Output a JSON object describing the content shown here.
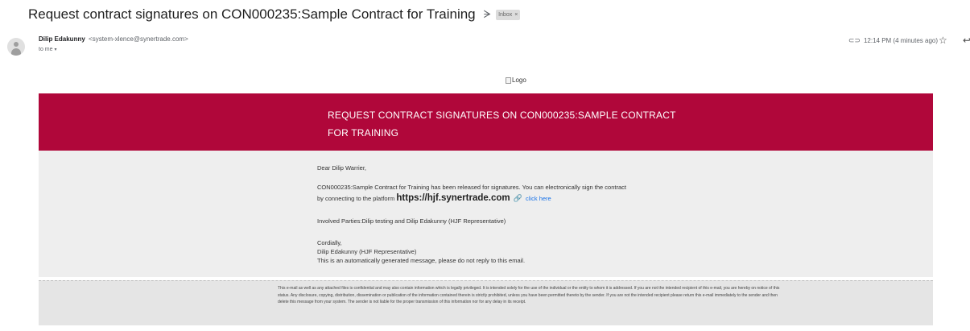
{
  "email": {
    "subject": "Request contract signatures on CON000235:Sample Contract for Training",
    "importance_icon": "label-importance-icon",
    "inbox_label": "Inbox",
    "inbox_close": "×",
    "sender_name": "Dilip Edakunny",
    "sender_address": "<system-xlence@synertrade.com>",
    "to_line": "to me",
    "time": "12:14 PM (4 minutes ago)",
    "icons": {
      "attachment": "paperclip-icon",
      "star": "star-icon",
      "reply": "reply-icon",
      "avatar": "avatar-icon"
    }
  },
  "body": {
    "logo_alt": "Logo",
    "banner_title_line1": "REQUEST CONTRACT SIGNATURES ON CON000235:SAMPLE CONTRACT",
    "banner_title_line2": "FOR TRAINING",
    "greeting": "Dear Dilip Warrier,",
    "para1_line1": "CON000235:Sample Contract for Training has been released for signatures. You can electronically sign the contract",
    "para1_line2_prefix": "by connecting to the platform",
    "platform_url": "https://hjf.synertrade.com",
    "click_here": "click here",
    "involved": "Involved Parties:Dilip testing and Dilip Edakunny (HJF Representative)",
    "closing": "Cordially,",
    "signature": "Dilip Edakunny (HJF Representative)",
    "auto_note": "This is an automatically generated message, please do not reply to this email.",
    "disclaimer": "This e-mail as well as any attached files is confidential and may also contain information which is legally privileged. It is intended solely for the use of the individual or the entity to whom it is addressed. If you are not the intended recipient of this e-mail, you are hereby on notice of this status. Any disclosure, copying, distribution, dissemination or publication of the information contained therein is strictly prohibited, unless you have been permitted thereto by the sender. If you are not the intended recipient please return this e-mail immediately to the sender and then delete this message from your system. The sender is not liable for the proper transmission of this information nor for any delay in its receipt."
  },
  "colors": {
    "banner": "#b0073a",
    "content_bg": "#eeeeee",
    "link": "#1a73e8"
  }
}
